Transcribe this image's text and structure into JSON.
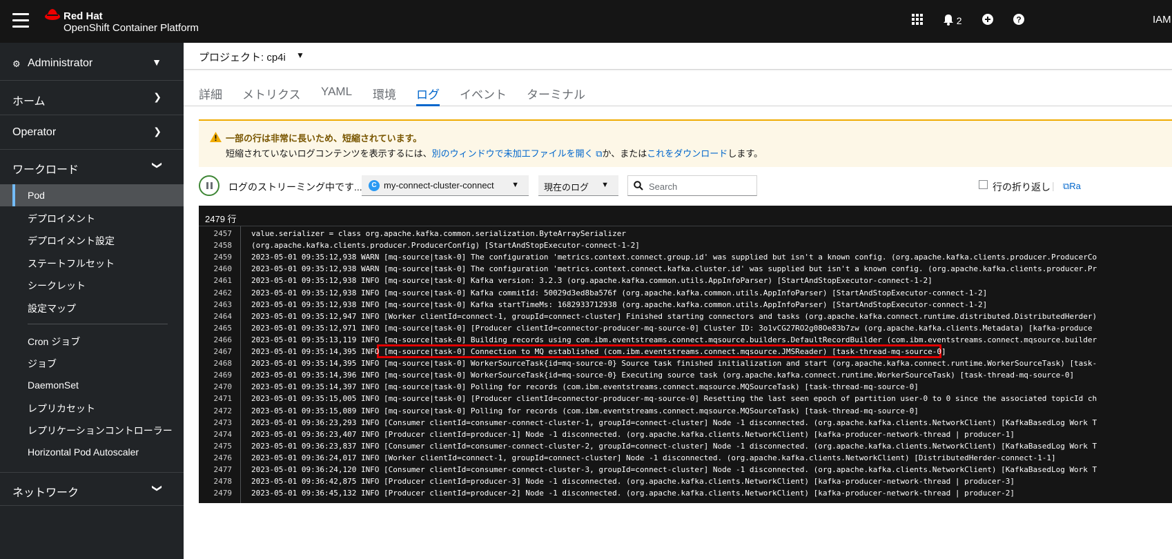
{
  "masthead": {
    "brand_top": "Red Hat",
    "brand_bottom": "OpenShift Container Platform",
    "notifications_count": "2",
    "user": "IAM",
    "icons": [
      "hamburger-icon",
      "redhat-logo",
      "grid-icon",
      "bell-icon",
      "plus-circle-icon",
      "question-icon"
    ]
  },
  "sidebar": {
    "perspective": "Administrator",
    "sections": {
      "home": "ホーム",
      "operator": "Operator",
      "workloads": "ワークロード",
      "network": "ネットワーク"
    },
    "workload_items": [
      "Pod",
      "デプロイメント",
      "デプロイメント設定",
      "ステートフルセット",
      "シークレット",
      "設定マップ",
      "Cron ジョブ",
      "ジョブ",
      "DaemonSet",
      "レプリカセット",
      "レプリケーションコントローラー",
      "Horizontal Pod Autoscaler"
    ],
    "active_item": "Pod"
  },
  "project": {
    "label": "プロジェクト: cp4i"
  },
  "tabs": [
    "詳細",
    "メトリクス",
    "YAML",
    "環境",
    "ログ",
    "イベント",
    "ターミナル"
  ],
  "active_tab": "ログ",
  "alert": {
    "title": "一部の行は非常に長いため、短縮されています。",
    "body_prefix": "短縮されていないログコンテンツを表示するには、",
    "link_raw": "別のウィンドウで未加工ファイルを開く",
    "body_middle": "か、または",
    "link_download": "これをダウンロード",
    "body_suffix": "します。"
  },
  "toolbar": {
    "streaming": "ログのストリーミング中です...",
    "container": "my-connect-cluster-connect",
    "container_badge": "C",
    "log_type": "現在のログ",
    "search_placeholder": "Search",
    "wrap_lines": "行の折り返し",
    "raw_label": "Ra"
  },
  "log": {
    "line_count": "2479 行",
    "lines": [
      {
        "n": "2457",
        "t": "value.serializer = class org.apache.kafka.common.serialization.ByteArraySerializer"
      },
      {
        "n": "2458",
        "t": "(org.apache.kafka.clients.producer.ProducerConfig) [StartAndStopExecutor-connect-1-2]"
      },
      {
        "n": "2459",
        "t": "2023-05-01 09:35:12,938 WARN [mq-source|task-0] The configuration 'metrics.context.connect.group.id' was supplied but isn't a known config. (org.apache.kafka.clients.producer.ProducerCo"
      },
      {
        "n": "2460",
        "t": "2023-05-01 09:35:12,938 WARN [mq-source|task-0] The configuration 'metrics.context.connect.kafka.cluster.id' was supplied but isn't a known config. (org.apache.kafka.clients.producer.Pr"
      },
      {
        "n": "2461",
        "t": "2023-05-01 09:35:12,938 INFO [mq-source|task-0] Kafka version: 3.2.3 (org.apache.kafka.common.utils.AppInfoParser) [StartAndStopExecutor-connect-1-2]"
      },
      {
        "n": "2462",
        "t": "2023-05-01 09:35:12,938 INFO [mq-source|task-0] Kafka commitId: 50029d3ed8ba576f (org.apache.kafka.common.utils.AppInfoParser) [StartAndStopExecutor-connect-1-2]"
      },
      {
        "n": "2463",
        "t": "2023-05-01 09:35:12,938 INFO [mq-source|task-0] Kafka startTimeMs: 1682933712938 (org.apache.kafka.common.utils.AppInfoParser) [StartAndStopExecutor-connect-1-2]"
      },
      {
        "n": "2464",
        "t": "2023-05-01 09:35:12,947 INFO [Worker clientId=connect-1, groupId=connect-cluster] Finished starting connectors and tasks (org.apache.kafka.connect.runtime.distributed.DistributedHerder)"
      },
      {
        "n": "2465",
        "t": "2023-05-01 09:35:12,971 INFO [mq-source|task-0] [Producer clientId=connector-producer-mq-source-0] Cluster ID: 3o1vCG27RO2g08Oe83b7zw (org.apache.kafka.clients.Metadata) [kafka-produce"
      },
      {
        "n": "2466",
        "t": "2023-05-01 09:35:13,119 INFO [mq-source|task-0] Building records using com.ibm.eventstreams.connect.mqsource.builders.DefaultRecordBuilder (com.ibm.eventstreams.connect.mqsource.builder"
      },
      {
        "n": "2467",
        "t": "2023-05-01 09:35:14,395 INFO [mq-source|task-0] Connection to MQ established (com.ibm.eventstreams.connect.mqsource.JMSReader) [task-thread-mq-source-0]"
      },
      {
        "n": "2468",
        "t": "2023-05-01 09:35:14,395 INFO [mq-source|task-0] WorkerSourceTask{id=mq-source-0} Source task finished initialization and start (org.apache.kafka.connect.runtime.WorkerSourceTask) [task-"
      },
      {
        "n": "2469",
        "t": "2023-05-01 09:35:14,396 INFO [mq-source|task-0] WorkerSourceTask{id=mq-source-0} Executing source task (org.apache.kafka.connect.runtime.WorkerSourceTask) [task-thread-mq-source-0]"
      },
      {
        "n": "2470",
        "t": "2023-05-01 09:35:14,397 INFO [mq-source|task-0] Polling for records (com.ibm.eventstreams.connect.mqsource.MQSourceTask) [task-thread-mq-source-0]"
      },
      {
        "n": "2471",
        "t": "2023-05-01 09:35:15,005 INFO [mq-source|task-0] [Producer clientId=connector-producer-mq-source-0] Resetting the last seen epoch of partition user-0 to 0 since the associated topicId ch"
      },
      {
        "n": "2472",
        "t": "2023-05-01 09:35:15,089 INFO [mq-source|task-0] Polling for records (com.ibm.eventstreams.connect.mqsource.MQSourceTask) [task-thread-mq-source-0]"
      },
      {
        "n": "2473",
        "t": "2023-05-01 09:36:23,293 INFO [Consumer clientId=consumer-connect-cluster-1, groupId=connect-cluster] Node -1 disconnected. (org.apache.kafka.clients.NetworkClient) [KafkaBasedLog Work T"
      },
      {
        "n": "2474",
        "t": "2023-05-01 09:36:23,407 INFO [Producer clientId=producer-1] Node -1 disconnected. (org.apache.kafka.clients.NetworkClient) [kafka-producer-network-thread | producer-1]"
      },
      {
        "n": "2475",
        "t": "2023-05-01 09:36:23,837 INFO [Consumer clientId=consumer-connect-cluster-2, groupId=connect-cluster] Node -1 disconnected. (org.apache.kafka.clients.NetworkClient) [KafkaBasedLog Work T"
      },
      {
        "n": "2476",
        "t": "2023-05-01 09:36:24,017 INFO [Worker clientId=connect-1, groupId=connect-cluster] Node -1 disconnected. (org.apache.kafka.clients.NetworkClient) [DistributedHerder-connect-1-1]"
      },
      {
        "n": "2477",
        "t": "2023-05-01 09:36:24,120 INFO [Consumer clientId=consumer-connect-cluster-3, groupId=connect-cluster] Node -1 disconnected. (org.apache.kafka.clients.NetworkClient) [KafkaBasedLog Work T"
      },
      {
        "n": "2478",
        "t": "2023-05-01 09:36:42,875 INFO [Producer clientId=producer-3] Node -1 disconnected. (org.apache.kafka.clients.NetworkClient) [kafka-producer-network-thread | producer-3]"
      },
      {
        "n": "2479",
        "t": "2023-05-01 09:36:45,132 INFO [Producer clientId=producer-2] Node -1 disconnected. (org.apache.kafka.clients.NetworkClient) [kafka-producer-network-thread | producer-2]"
      }
    ],
    "highlighted_line": "2467"
  },
  "colors": {
    "masthead_bg": "#151515",
    "sidebar_bg": "#212427",
    "active_nav_bg": "#4f5255",
    "link_blue": "#0066cc",
    "warning_gold": "#f0ab00",
    "streaming_green": "#3e8635",
    "highlight_red": "#e00000"
  }
}
